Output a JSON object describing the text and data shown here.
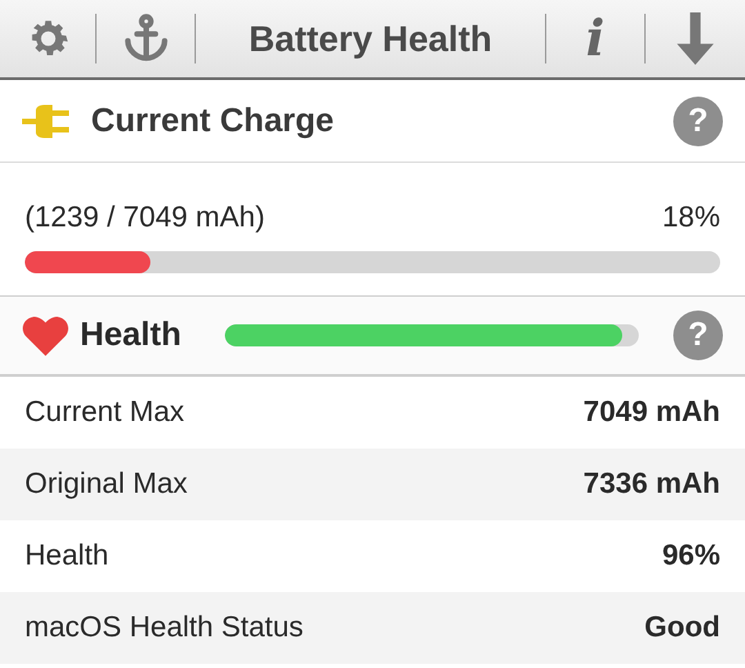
{
  "toolbar": {
    "title": "Battery Health",
    "info_label": "i"
  },
  "current_charge": {
    "title": "Current Charge",
    "help": "?",
    "reading": "(1239 / 7049 mAh)",
    "percent": "18%",
    "level": 0.18
  },
  "health": {
    "title": "Health",
    "help": "?",
    "level": 0.96
  },
  "rows": [
    {
      "label": "Current Max",
      "value": "7049 mAh"
    },
    {
      "label": "Original Max",
      "value": "7336 mAh"
    },
    {
      "label": "Health",
      "value": "96%"
    },
    {
      "label": "macOS Health Status",
      "value": "Good"
    }
  ]
}
